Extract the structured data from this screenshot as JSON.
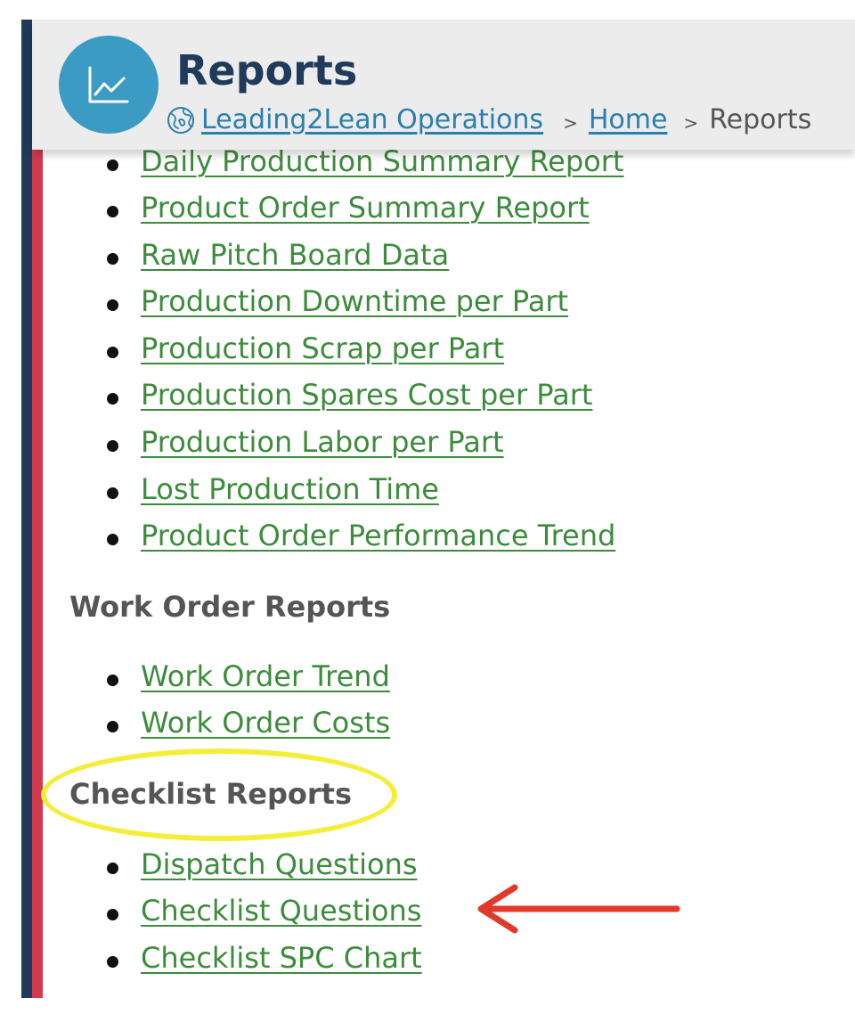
{
  "header": {
    "title": "Reports",
    "breadcrumb": {
      "root": "Leading2Lean Operations",
      "home": "Home",
      "current": "Reports",
      "separator": ">"
    }
  },
  "production_reports": [
    "Daily Production Summary Report",
    "Product Order Summary Report",
    "Raw Pitch Board Data",
    "Production Downtime per Part",
    "Production Scrap per Part",
    "Production Spares Cost per Part",
    "Production Labor per Part",
    "Lost Production Time",
    "Product Order Performance Trend"
  ],
  "work_order_section": {
    "heading": "Work Order Reports",
    "items": [
      "Work Order Trend",
      "Work Order Costs"
    ]
  },
  "checklist_section": {
    "heading": "Checklist Reports",
    "items": [
      "Dispatch Questions",
      "Checklist Questions",
      "Checklist SPC Chart"
    ]
  },
  "icons": {
    "app": "line-chart-icon",
    "breadcrumb_root": "globe-icon"
  },
  "colors": {
    "navy": "#1f3a5a",
    "accent_red": "#d13a4c",
    "icon_blue": "#3b9bc3",
    "link_green": "#3c8c3c",
    "breadcrumb_link": "#2a7fb0",
    "highlight_yellow": "#f4ee3a",
    "arrow_red": "#e23a2a"
  }
}
